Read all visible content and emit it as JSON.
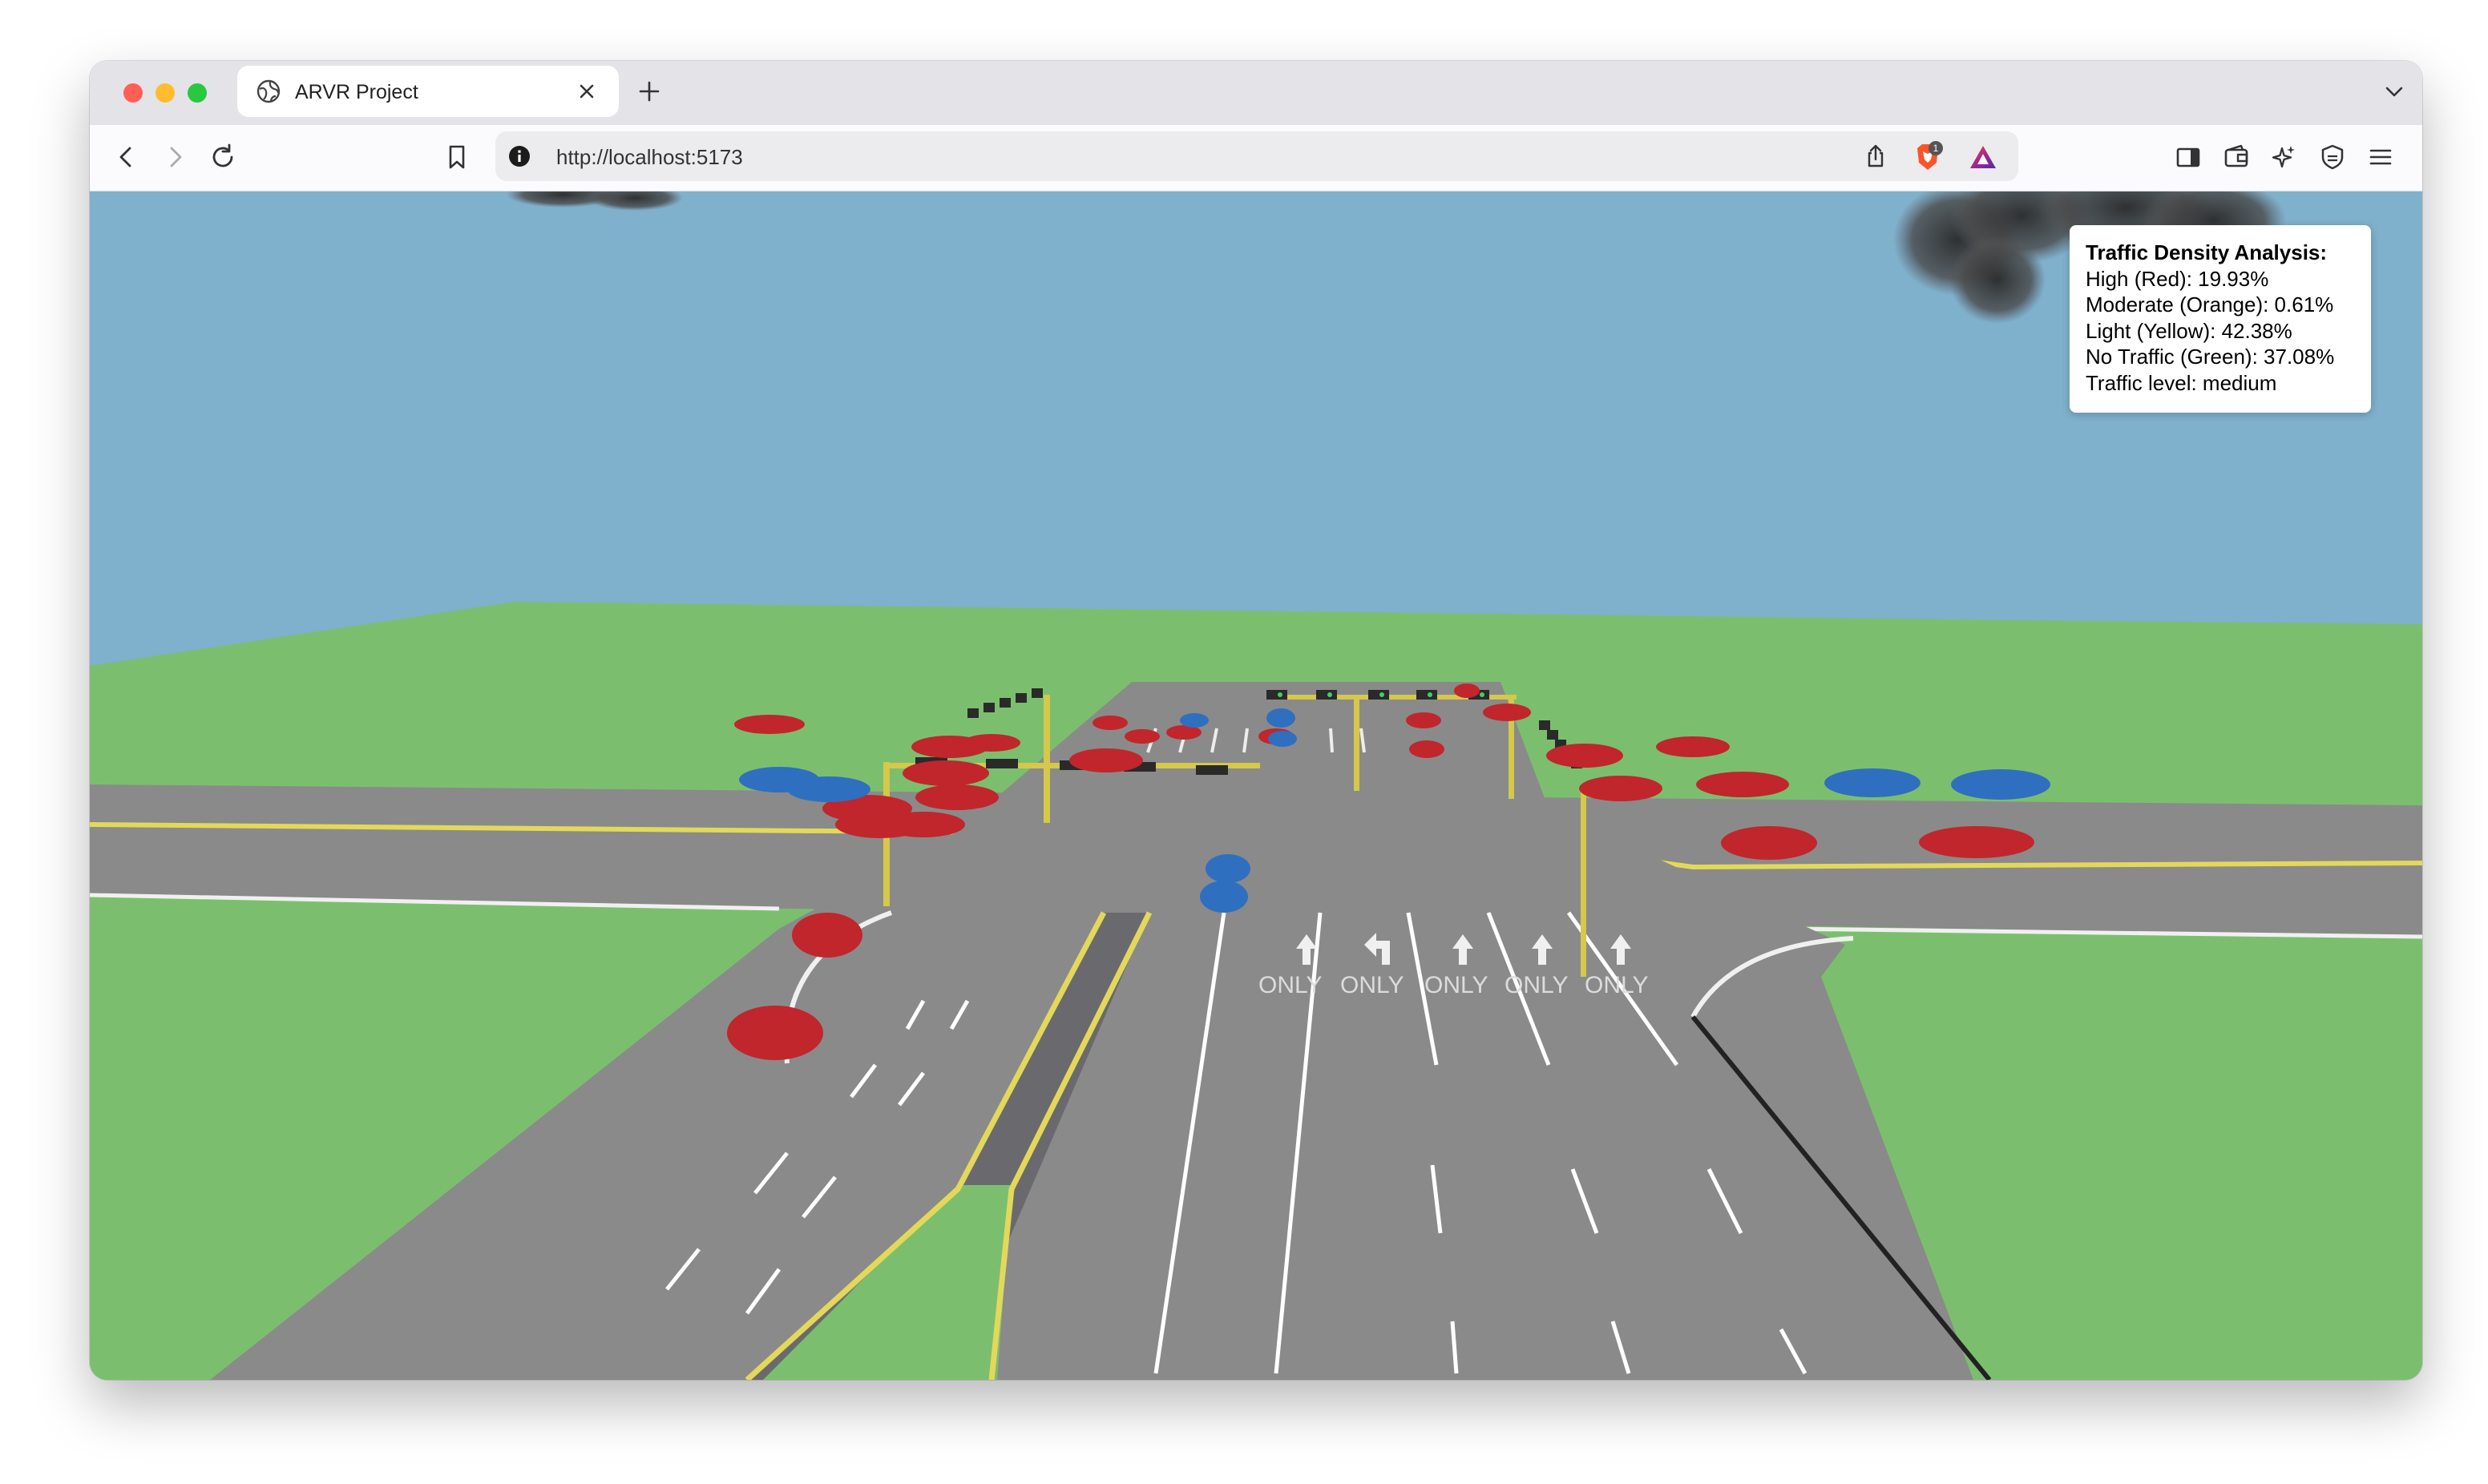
{
  "browser": {
    "tab_title": "ARVR Project",
    "url": "http://localhost:5173",
    "shield_badge": "1"
  },
  "scene": {
    "lane_marking": "ONLY",
    "colors": {
      "sky": "#7fb0cc",
      "grass": "#7bbf6e",
      "road": "#8a8a8a",
      "curb_line": "#e3d85a",
      "car_red": "#c0262b",
      "car_blue": "#2f6fbf"
    }
  },
  "overlay": {
    "title": "Traffic Density Analysis:",
    "high": "High (Red): 19.93%",
    "moderate": "Moderate (Orange): 0.61%",
    "light": "Light (Yellow): 42.38%",
    "none": "No Traffic (Green): 37.08%",
    "level": "Traffic level: medium"
  }
}
